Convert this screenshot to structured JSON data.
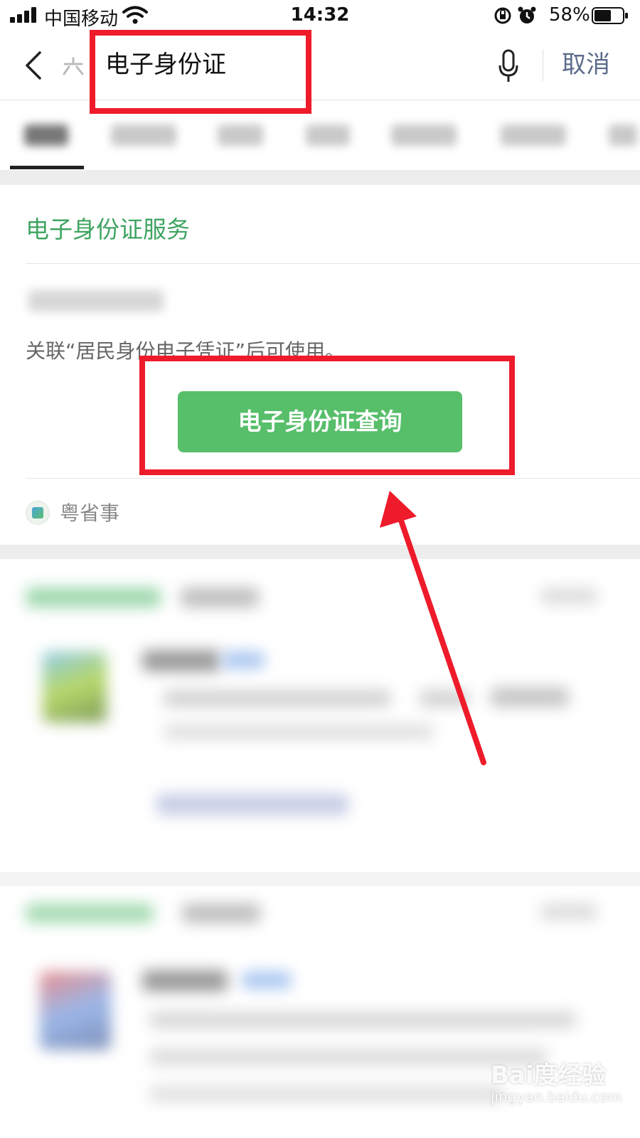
{
  "status_bar": {
    "carrier": "中国移动",
    "time": "14:32",
    "battery": "58%"
  },
  "header": {
    "search_value": "电子身份证",
    "cancel_label": "取消"
  },
  "card": {
    "title": "电子身份证服务",
    "description": "关联“居民身份电子凭证”后可使用。",
    "button_label": "电子身份证查询",
    "provider": "粤省事"
  },
  "watermark": {
    "brand": "Bai度经验",
    "url": "jingyan.baidu.com"
  },
  "colors": {
    "accent_green": "#57be6a",
    "title_green": "#3fa462",
    "annotation_red": "#ee1b2b",
    "cancel_blue": "#5b6b8c"
  }
}
